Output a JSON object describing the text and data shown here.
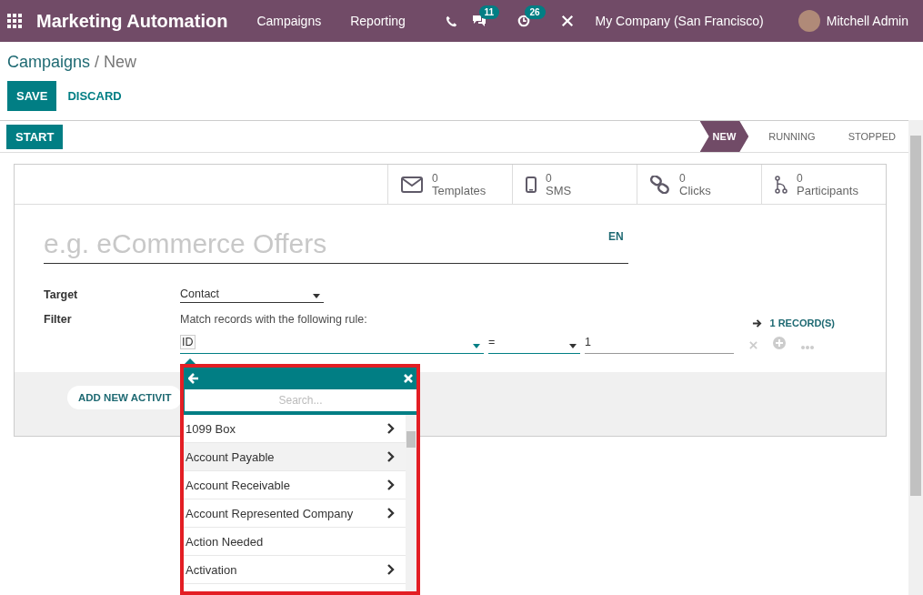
{
  "navbar": {
    "app_title": "Marketing Automation",
    "menu": [
      "Campaigns",
      "Reporting"
    ],
    "messages_badge": "11",
    "activities_badge": "26",
    "company": "My Company (San Francisco)",
    "user": "Mitchell Admin"
  },
  "breadcrumb": {
    "parent": "Campaigns",
    "separator": "/",
    "current": "New"
  },
  "buttons": {
    "save": "SAVE",
    "discard": "DISCARD",
    "start": "START"
  },
  "stages": [
    {
      "label": "NEW",
      "selected": true
    },
    {
      "label": "RUNNING",
      "selected": false
    },
    {
      "label": "STOPPED",
      "selected": false
    }
  ],
  "stat_buttons": [
    {
      "value": "0",
      "label": "Templates"
    },
    {
      "value": "0",
      "label": "SMS"
    },
    {
      "value": "0",
      "label": "Clicks"
    },
    {
      "value": "0",
      "label": "Participants"
    }
  ],
  "form": {
    "name_placeholder": "e.g. eCommerce Offers",
    "language": "EN",
    "target_label": "Target",
    "target_value": "Contact",
    "filter_label": "Filter",
    "filter_hint": "Match records with the following rule:",
    "record_count": "1 RECORD(S)",
    "rule": {
      "field": "ID",
      "operator": "=",
      "value": "1"
    },
    "add_activity": "ADD NEW ACTIVIT"
  },
  "field_popup": {
    "search_placeholder": "Search...",
    "items": [
      {
        "label": "1099 Box",
        "expandable": true,
        "selected": false
      },
      {
        "label": "Account Payable",
        "expandable": true,
        "selected": true
      },
      {
        "label": "Account Receivable",
        "expandable": true,
        "selected": false
      },
      {
        "label": "Account Represented Company",
        "expandable": true,
        "selected": false
      },
      {
        "label": "Action Needed",
        "expandable": false,
        "selected": false
      },
      {
        "label": "Activation",
        "expandable": true,
        "selected": false
      }
    ]
  }
}
